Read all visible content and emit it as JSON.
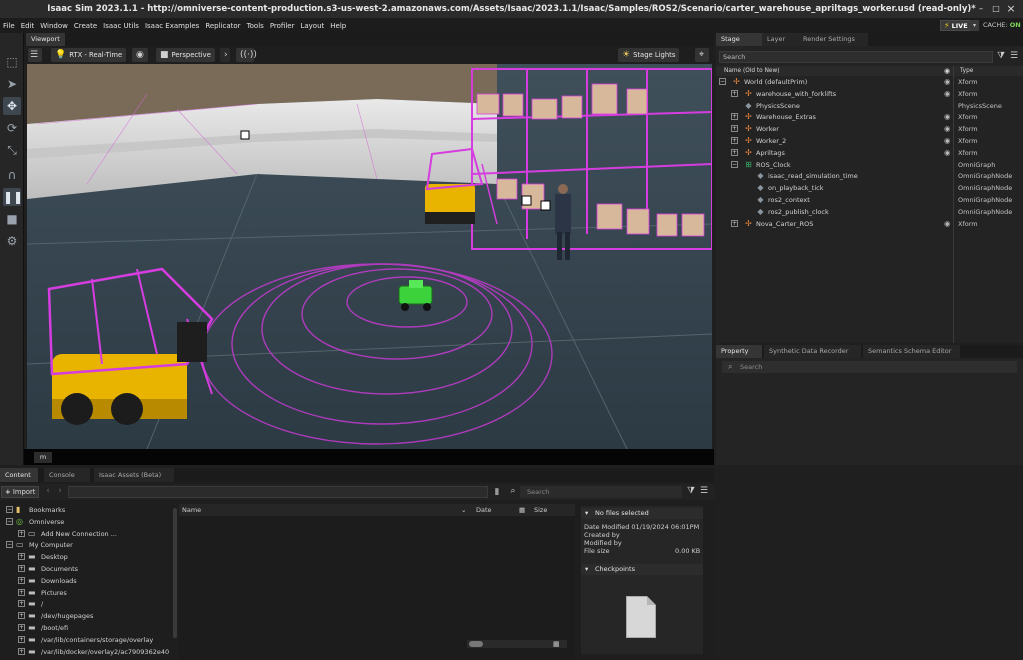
{
  "window": {
    "title": "Isaac Sim 2023.1.1 - http://omniverse-content-production.s3-us-west-2.amazonaws.com/Assets/Isaac/2023.1.1/Isaac/Samples/ROS2/Scenario/carter_warehouse_apriltags_worker.usd (read-only)*",
    "minimize": "–",
    "maximize": "□",
    "close": "×"
  },
  "menu": [
    "File",
    "Edit",
    "Window",
    "Create",
    "Isaac Utils",
    "Isaac Examples",
    "Replicator",
    "Tools",
    "Profiler",
    "Layout",
    "Help"
  ],
  "status": {
    "live": "LIVE",
    "cache_label": "CACHE:",
    "cache_value": "ON"
  },
  "viewport": {
    "tab": "Viewport",
    "renderer": "RTX - Real-Time",
    "camera": "Perspective",
    "stage_lights": "Stage Lights",
    "units": "m"
  },
  "stage": {
    "tabs": [
      "Stage",
      "Layer",
      "Render Settings"
    ],
    "search_placeholder": "Search",
    "col_name": "Name (Old to New)",
    "col_type": "Type",
    "rows": [
      {
        "label": "World (defaultPrim)",
        "type": "Xform",
        "icon": "xform-icon"
      },
      {
        "label": "warehouse_with_forklifts",
        "type": "Xform",
        "icon": "xform-icon"
      },
      {
        "label": "PhysicsScene",
        "type": "PhysicsScene",
        "icon": "cube-icon"
      },
      {
        "label": "Warehouse_Extras",
        "type": "Xform",
        "icon": "xform-icon"
      },
      {
        "label": "Worker",
        "type": "Xform",
        "icon": "xform-icon"
      },
      {
        "label": "Worker_2",
        "type": "Xform",
        "icon": "xform-icon"
      },
      {
        "label": "Apriltags",
        "type": "Xform",
        "icon": "xform-icon"
      },
      {
        "label": "ROS_Clock",
        "type": "OmniGraph",
        "icon": "graph-icon"
      },
      {
        "label": "isaac_read_simulation_time",
        "type": "OmniGraphNode",
        "icon": "cube-icon"
      },
      {
        "label": "on_playback_tick",
        "type": "OmniGraphNode",
        "icon": "cube-icon"
      },
      {
        "label": "ros2_context",
        "type": "OmniGraphNode",
        "icon": "cube-icon"
      },
      {
        "label": "ros2_publish_clock",
        "type": "OmniGraphNode",
        "icon": "cube-icon"
      },
      {
        "label": "Nova_Carter_ROS",
        "type": "Xform",
        "icon": "xform-icon"
      }
    ]
  },
  "property": {
    "tabs": [
      "Property",
      "Synthetic Data Recorder",
      "Semantics Schema Editor"
    ],
    "search_placeholder": "Search"
  },
  "content": {
    "tabs": [
      "Content",
      "Console",
      "Isaac Assets (Beta)"
    ],
    "import_label": "Import",
    "search_placeholder": "Search",
    "tree": [
      {
        "label": "Bookmarks",
        "icon": "bookmark-icon"
      },
      {
        "label": "Omniverse",
        "icon": "omniverse-icon"
      },
      {
        "label": "Add New Connection ...",
        "icon": "connection-icon"
      },
      {
        "label": "My Computer",
        "icon": "computer-icon"
      },
      {
        "label": "Desktop",
        "icon": "drive-icon"
      },
      {
        "label": "Documents",
        "icon": "drive-icon"
      },
      {
        "label": "Downloads",
        "icon": "drive-icon"
      },
      {
        "label": "Pictures",
        "icon": "drive-icon"
      },
      {
        "label": "/",
        "icon": "drive-icon"
      },
      {
        "label": "/dev/hugepages",
        "icon": "drive-icon"
      },
      {
        "label": "/boot/efi",
        "icon": "drive-icon"
      },
      {
        "label": "/var/lib/containers/storage/overlay",
        "icon": "drive-icon"
      },
      {
        "label": "/var/lib/docker/overlay2/ac7909362e40",
        "icon": "drive-icon"
      }
    ],
    "columns": {
      "name": "Name",
      "date": "Date",
      "size": "Size"
    },
    "detail": {
      "no_files": "No files selected",
      "date_modified": "Date Modified 01/19/2024 06:01PM",
      "created_by": "Created by",
      "modified_by": "Modified by",
      "file_size_label": "File size",
      "file_size_value": "0.00 KB",
      "checkpoints": "Checkpoints"
    }
  }
}
